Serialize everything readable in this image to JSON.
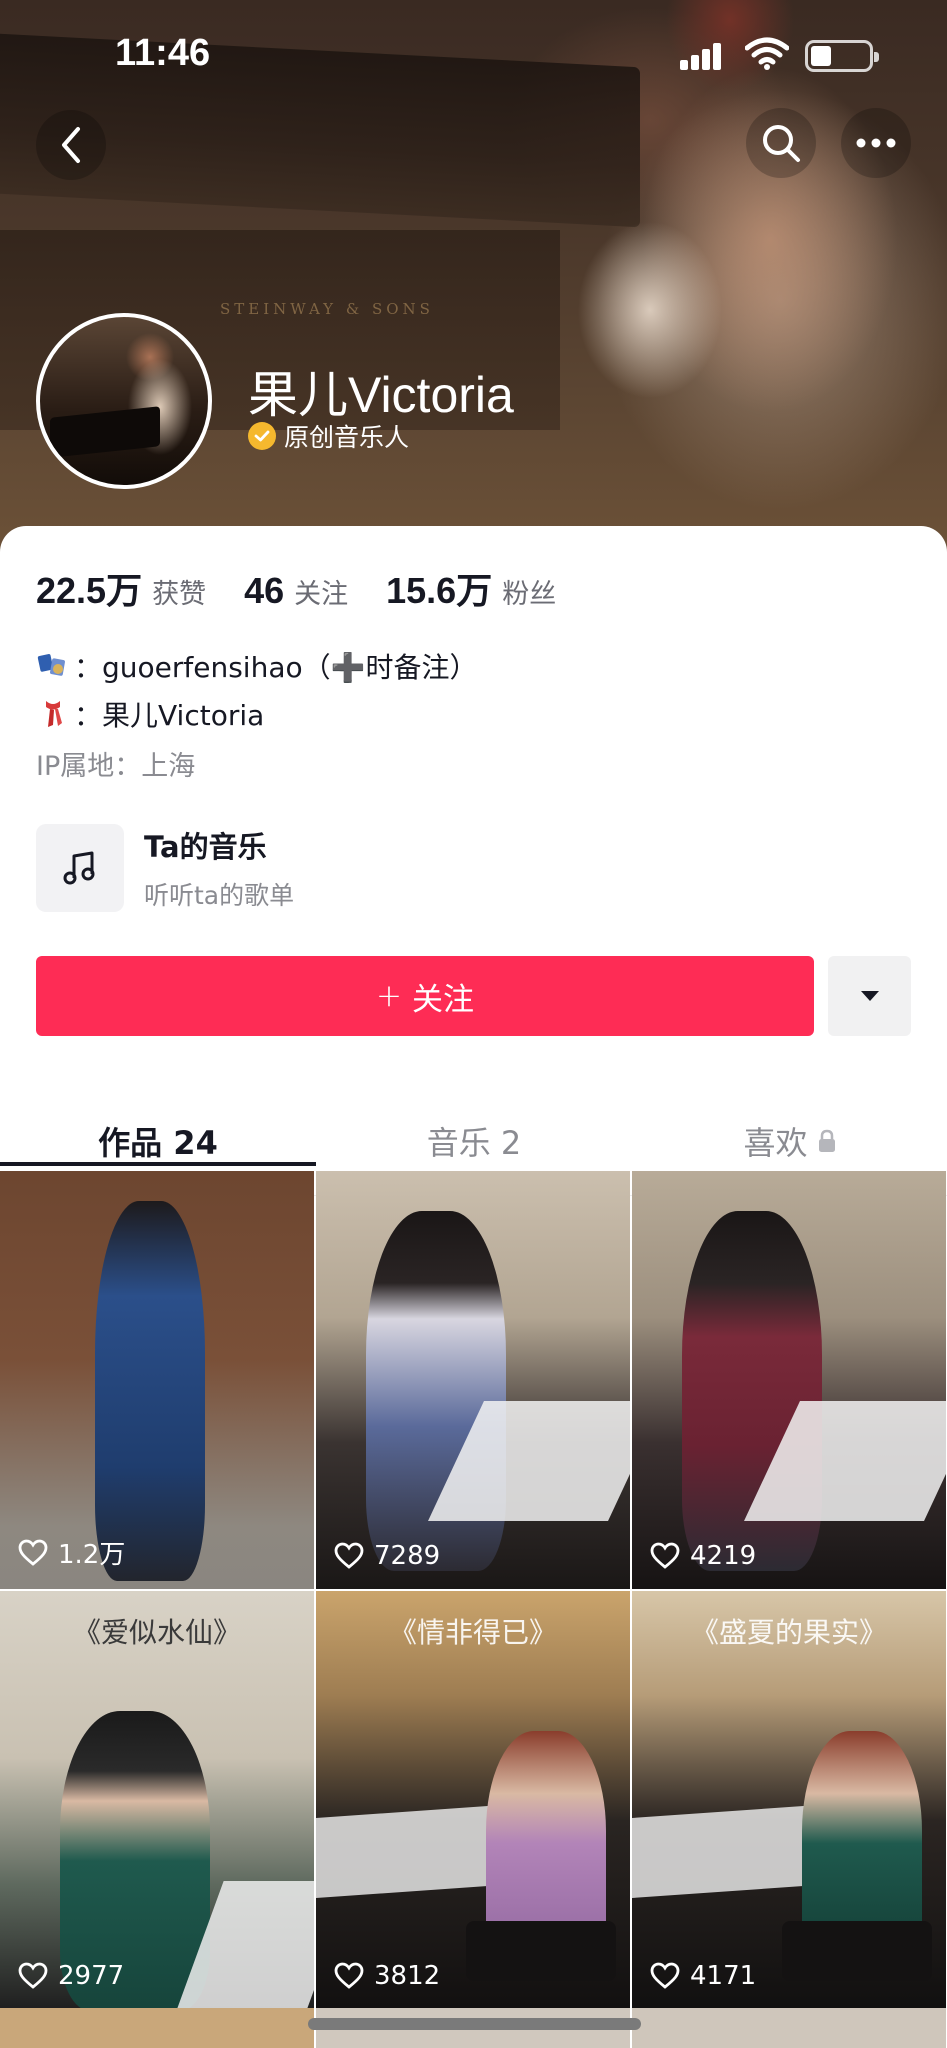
{
  "status_bar": {
    "time": "11:46"
  },
  "header": {
    "brand_mark": "STEINWAY & SONS"
  },
  "profile": {
    "name": "果儿Victoria",
    "verify_label": "原创音乐人"
  },
  "stats": [
    {
      "value": "22.5万",
      "label": "获赞"
    },
    {
      "value": "46",
      "label": "关注"
    },
    {
      "value": "15.6万",
      "label": "粉丝"
    }
  ],
  "bio": {
    "line1": "：guoerfensihao（➕时备注）",
    "line2": "：果儿Victoria",
    "ip": "IP属地：上海"
  },
  "music_entry": {
    "title": "Ta的音乐",
    "subtitle": "听听ta的歌单"
  },
  "follow_button": {
    "label": "关注"
  },
  "tabs": [
    {
      "label": "作品 24",
      "active": true
    },
    {
      "label": "音乐 2",
      "active": false
    },
    {
      "label": "喜欢",
      "active": false,
      "locked": true
    }
  ],
  "videos": [
    {
      "likes": "1.2万",
      "overlay_title": ""
    },
    {
      "likes": "7289",
      "overlay_title": ""
    },
    {
      "likes": "4219",
      "overlay_title": ""
    },
    {
      "likes": "2977",
      "overlay_title": "《爱似水仙》"
    },
    {
      "likes": "3812",
      "overlay_title": "《情非得已》"
    },
    {
      "likes": "4171",
      "overlay_title": "《盛夏的果实》"
    }
  ],
  "colors": {
    "accent": "#fe2c55",
    "verify": "#f5b82e",
    "text_primary": "#161823",
    "text_secondary": "#8a8b91"
  }
}
